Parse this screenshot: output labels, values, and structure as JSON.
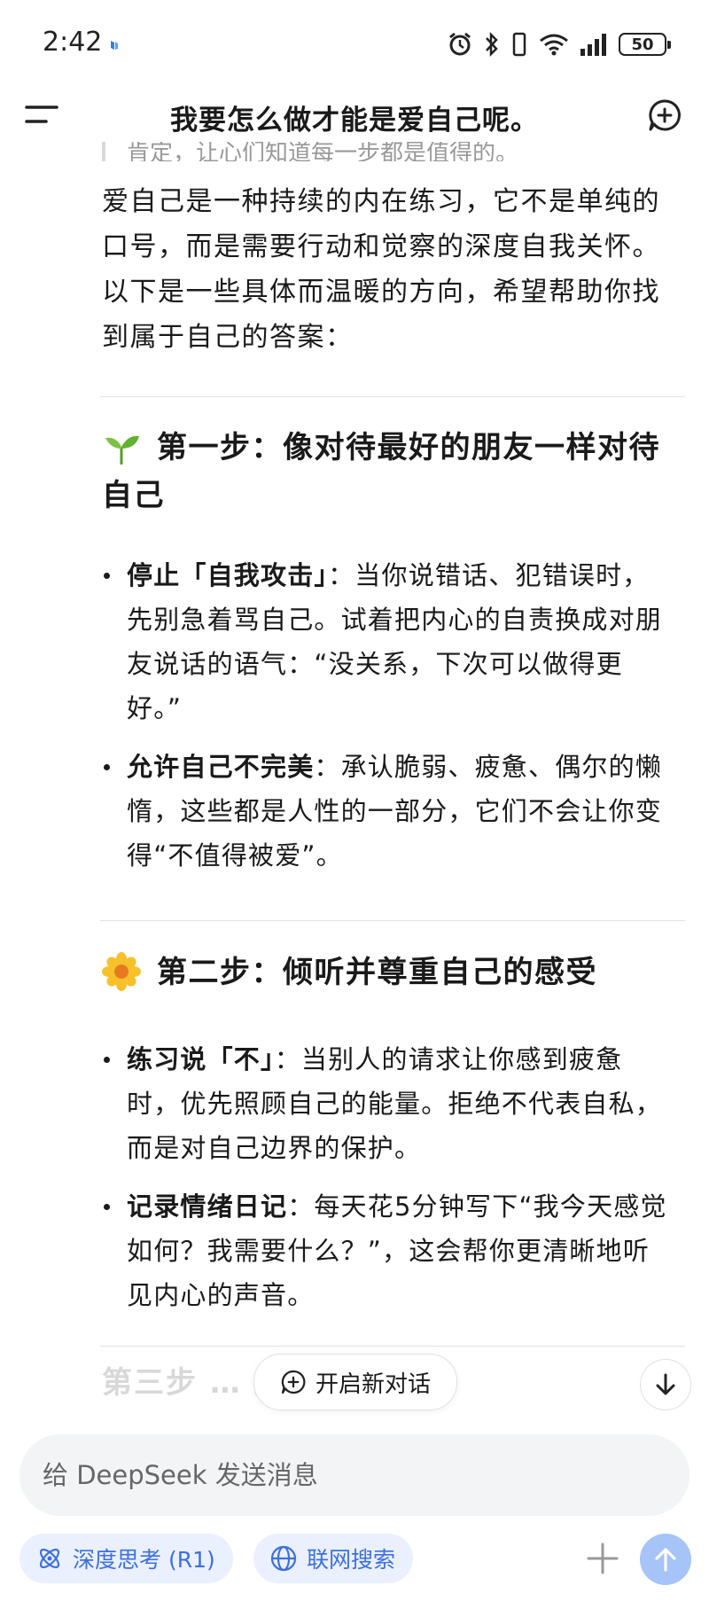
{
  "status_bar": {
    "time": "2:42",
    "battery": "50"
  },
  "header": {
    "title": "我要怎么做才能是爱自己呢。"
  },
  "message": {
    "quote_cut": "肯定，让心们知道每一步都是值得的。",
    "intro": "爱自己是一种持续的内在练习，它不是单纯的口号，而是需要行动和觉察的深度自我关怀。以下是一些具体而温暖的方向，希望帮助你找到属于自己的答案：",
    "sections": [
      {
        "emoji": "seedling-icon",
        "title": "第一步：像对待最好的朋友一样对待自己",
        "bullets": [
          {
            "bold": "停止「自我攻击」",
            "text": "：当你说错话、犯错误时，先别急着骂自己。试着把内心的自责换成对朋友说话的语气：“没关系，下次可以做得更好。”"
          },
          {
            "bold": "允许自己不完美",
            "text": "：承认脆弱、疲惫、偶尔的懒惰，这些都是人性的一部分，它们不会让你变得“不值得被爱”。"
          }
        ]
      },
      {
        "emoji": "blossom-icon",
        "title": "第二步：倾听并尊重自己的感受",
        "bullets": [
          {
            "bold": "练习说「不」",
            "text": "：当别人的请求让你感到疲惫时，优先照顾自己的能量。拒绝不代表自私，而是对自己边界的保护。"
          },
          {
            "bold": "记录情绪日记",
            "text": "：每天花5分钟写下“我今天感觉如何？我需要什么？”，这会帮你更清晰地听见内心的声音。"
          }
        ]
      }
    ],
    "faded_heading": "第三步 … 身心"
  },
  "floating": {
    "new_chat_label": "开启新对话"
  },
  "composer": {
    "placeholder": "给 DeepSeek 发送消息",
    "deep_think_label": "深度思考 (R1)",
    "web_search_label": "联网搜索"
  },
  "colors": {
    "accent": "#3d6fe0",
    "send_disabled": "#a6c4f7",
    "chip_bg": "#eaf0fd"
  }
}
